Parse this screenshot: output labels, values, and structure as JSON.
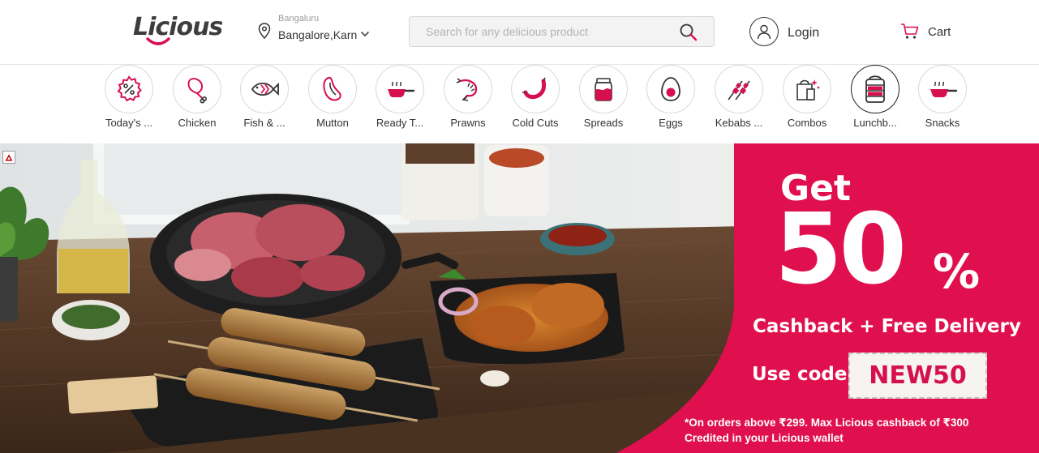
{
  "header": {
    "logo_text": "Licious",
    "location": {
      "city": "Bangaluru",
      "area": "Bangalore,Karn"
    },
    "search": {
      "placeholder": "Search for any delicious product"
    },
    "login_label": "Login",
    "cart_label": "Cart"
  },
  "categories": [
    {
      "label": "Today's ...",
      "icon": "discount-badge-icon"
    },
    {
      "label": "Chicken",
      "icon": "chicken-leg-icon"
    },
    {
      "label": "Fish & ...",
      "icon": "fish-icon"
    },
    {
      "label": "Mutton",
      "icon": "mutton-icon"
    },
    {
      "label": "Ready T...",
      "icon": "pan-icon"
    },
    {
      "label": "Prawns",
      "icon": "prawn-icon"
    },
    {
      "label": "Cold Cuts",
      "icon": "sausage-icon"
    },
    {
      "label": "Spreads",
      "icon": "jar-icon"
    },
    {
      "label": "Eggs",
      "icon": "egg-icon"
    },
    {
      "label": "Kebabs ...",
      "icon": "skewer-icon"
    },
    {
      "label": "Combos",
      "icon": "bag-icon"
    },
    {
      "label": "Lunchb...",
      "icon": "lunchbox-icon",
      "active": true
    },
    {
      "label": "Snacks",
      "icon": "snack-pan-icon"
    }
  ],
  "banner": {
    "headline": "Get",
    "discount": "50",
    "percent": "%",
    "subtitle": "Cashback + Free Delivery",
    "use_code_label": "Use code",
    "code": "NEW50",
    "terms_line1": "*On orders above ₹299. Max Licious cashback of ₹300",
    "terms_line2": "Credited in your Licious wallet"
  },
  "colors": {
    "brand": "#d6104f",
    "promo_bg": "#e0104f",
    "text": "#333333"
  }
}
